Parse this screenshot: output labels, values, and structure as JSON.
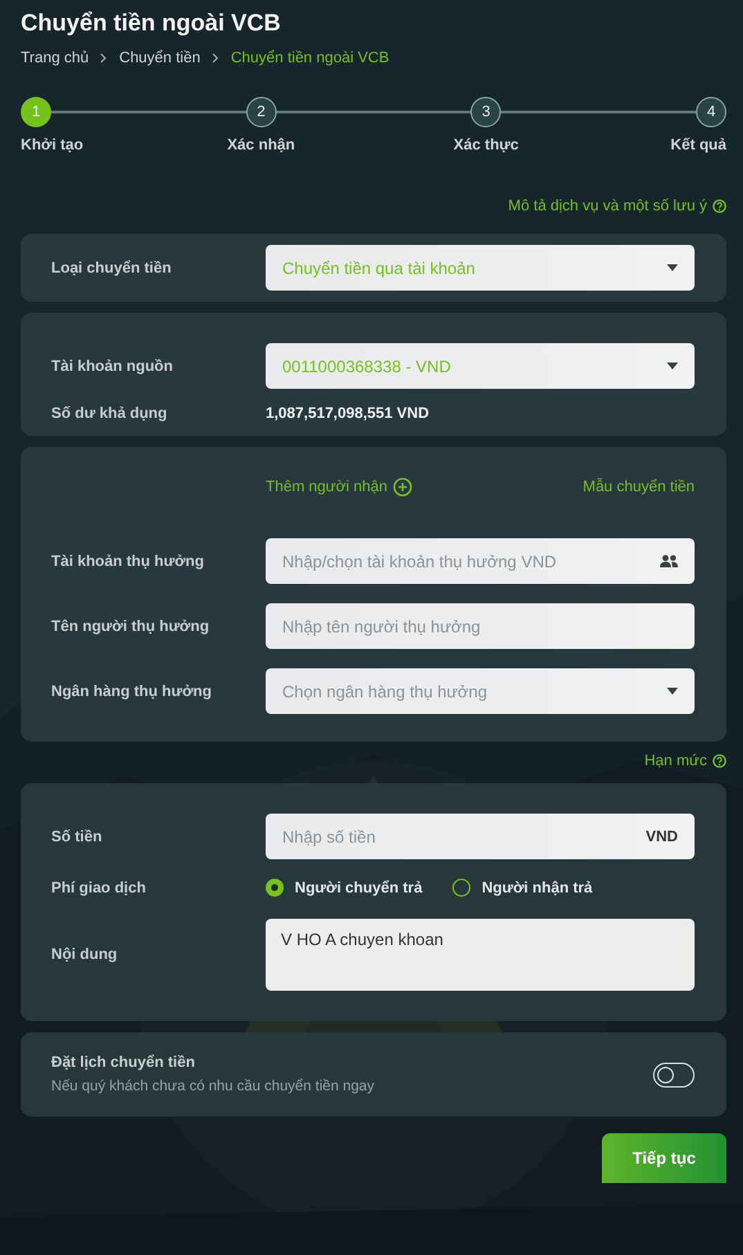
{
  "title": "Chuyển tiền ngoài VCB",
  "breadcrumb": [
    {
      "label": "Trang chủ",
      "current": false
    },
    {
      "label": "Chuyển tiền",
      "current": false
    },
    {
      "label": "Chuyển tiền ngoài VCB",
      "current": true
    }
  ],
  "steps": [
    {
      "number": "1",
      "label": "Khởi tạo",
      "selected": true
    },
    {
      "number": "2",
      "label": "Xác nhận",
      "selected": false
    },
    {
      "number": "3",
      "label": "Xác thực",
      "selected": false
    },
    {
      "number": "4",
      "label": "Kết quả",
      "selected": false
    }
  ],
  "help_link": "Mô tả dịch vụ và một số lưu ý",
  "transfer_type": {
    "label": "Loại chuyển tiền",
    "value": "Chuyển tiền qua tài khoản"
  },
  "source": {
    "account_label": "Tài khoản nguồn",
    "account_value": "0011000368338 - VND",
    "balance_label": "Số dư khả dụng",
    "balance_value": "1,087,517,098,551 VND"
  },
  "recipient": {
    "add_link": "Thêm người nhận",
    "template_link": "Mẫu chuyển tiền",
    "fields": [
      {
        "kind": "contacts",
        "label": "Tài khoản thụ hưởng",
        "placeholder": "Nhập/chọn tài khoản thụ hưởng VND"
      },
      {
        "kind": "input",
        "label": "Tên người thụ hưởng",
        "placeholder": "Nhập tên người thụ hưởng"
      },
      {
        "kind": "select",
        "label": "Ngân hàng thụ hưởng",
        "placeholder": "Chọn ngân hàng thụ hưởng"
      }
    ]
  },
  "limit_link": "Hạn mức",
  "payment": {
    "amount_label": "Số tiền",
    "amount_placeholder": "Nhập số tiền",
    "currency": "VND",
    "fee_label": "Phí giao dịch",
    "fee_options": [
      {
        "label": "Người chuyển trả",
        "selected": true
      },
      {
        "label": "Người nhận trả",
        "selected": false
      }
    ],
    "content_label": "Nội dung",
    "content_value": "V HO A chuyen khoan"
  },
  "schedule": {
    "title": "Đặt lịch chuyển tiền",
    "subtitle": "Nếu quý khách chưa có nhu cầu chuyển tiền ngay",
    "on": false
  },
  "continue_button": "Tiếp tục"
}
